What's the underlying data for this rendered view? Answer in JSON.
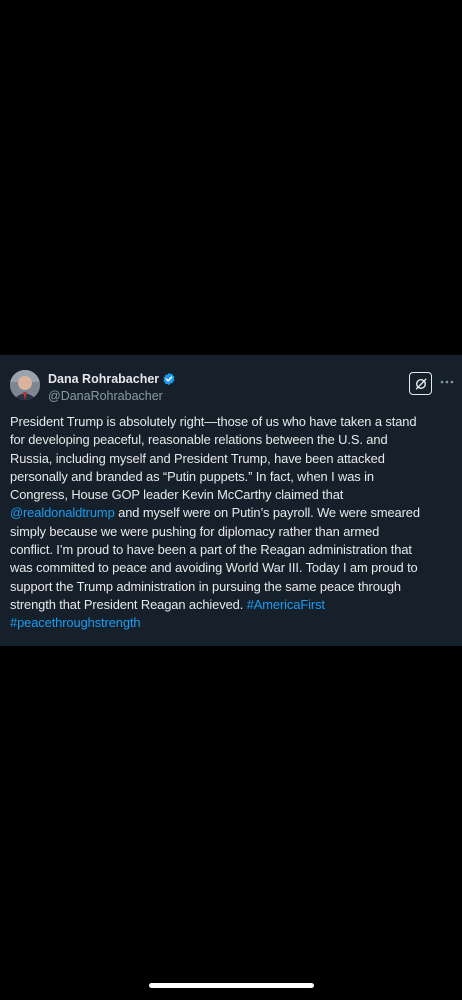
{
  "author": {
    "display_name": "Dana Rohrabacher",
    "handle": "@DanaRohrabacher",
    "verified": true
  },
  "actions": {
    "grok_icon": "grok-icon",
    "more_icon": "more-horizontal-icon"
  },
  "tweet": {
    "lines": [
      {
        "text": "President Trump is absolutely right—those of us who have taken a stand"
      },
      {
        "text": "for developing peaceful, reasonable relations between the U.S. and"
      },
      {
        "text": "Russia, including myself and President Trump, have been attacked"
      },
      {
        "text": "personally and branded as “Putin puppets.” In fact, when I was in"
      },
      {
        "text": "Congress, House GOP leader Kevin McCarthy claimed that"
      },
      {
        "mention": "@realdonaldtrump",
        "text": " and myself were on Putin’s payroll. We were smeared"
      },
      {
        "text": "simply because we were pushing for diplomacy rather than armed"
      },
      {
        "text": "conflict. I’m proud to have been a part of the Reagan administration that"
      },
      {
        "text": "was committed to peace and avoiding World War III.  Today I am proud to"
      },
      {
        "text": "support the Trump administration in pursuing the same peace through"
      },
      {
        "text": "strength that President Reagan achieved. ",
        "hashtag": "#AmericaFirst"
      },
      {
        "hashtag": "#peacethroughstrength"
      }
    ]
  },
  "colors": {
    "card_background": "#15202b",
    "text": "#e7e9ea",
    "secondary_text": "#8b98a5",
    "link": "#1d9bf0",
    "page_background": "#000000"
  }
}
